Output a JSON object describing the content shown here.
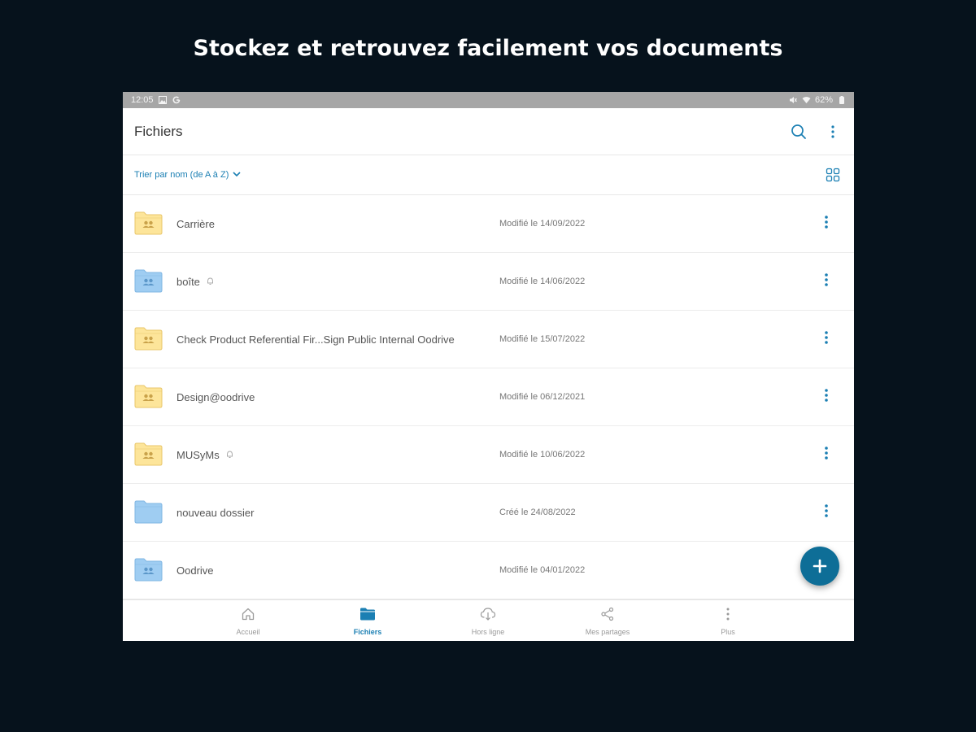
{
  "headline": "Stockez et retrouvez facilement vos documents",
  "status_bar": {
    "time": "12:05",
    "battery": "62%"
  },
  "app_bar": {
    "title": "Fichiers"
  },
  "sort": {
    "label": "Trier par nom (de A à Z)"
  },
  "colors": {
    "accent": "#1b7fb3",
    "fab": "#0e6e97",
    "folder_yellow": "#fde59a",
    "folder_blue": "#9fcdf2"
  },
  "files": [
    {
      "name": "Carrière",
      "date": "Modifié le 14/09/2022",
      "color": "yellow",
      "shared": true,
      "badge": false
    },
    {
      "name": "boîte",
      "date": "Modifié le 14/06/2022",
      "color": "blue",
      "shared": true,
      "badge": true
    },
    {
      "name": "Check Product Referential Fir...Sign Public Internal Oodrive",
      "date": "Modifié le 15/07/2022",
      "color": "yellow",
      "shared": true,
      "badge": false
    },
    {
      "name": "Design@oodrive",
      "date": "Modifié le 06/12/2021",
      "color": "yellow",
      "shared": true,
      "badge": false
    },
    {
      "name": "MUSyMs",
      "date": "Modifié le 10/06/2022",
      "color": "yellow",
      "shared": true,
      "badge": true
    },
    {
      "name": "nouveau dossier",
      "date": "Créé le 24/08/2022",
      "color": "blue",
      "shared": false,
      "badge": false
    },
    {
      "name": "Oodrive",
      "date": "Modifié le 04/01/2022",
      "color": "blue",
      "shared": true,
      "badge": false
    }
  ],
  "nav": [
    {
      "label": "Accueil",
      "icon": "home-icon",
      "active": false
    },
    {
      "label": "Fichiers",
      "icon": "folder-icon",
      "active": true
    },
    {
      "label": "Hors ligne",
      "icon": "cloud-download-icon",
      "active": false
    },
    {
      "label": "Mes partages",
      "icon": "share-icon",
      "active": false
    },
    {
      "label": "Plus",
      "icon": "more-vertical-icon",
      "active": false
    }
  ]
}
